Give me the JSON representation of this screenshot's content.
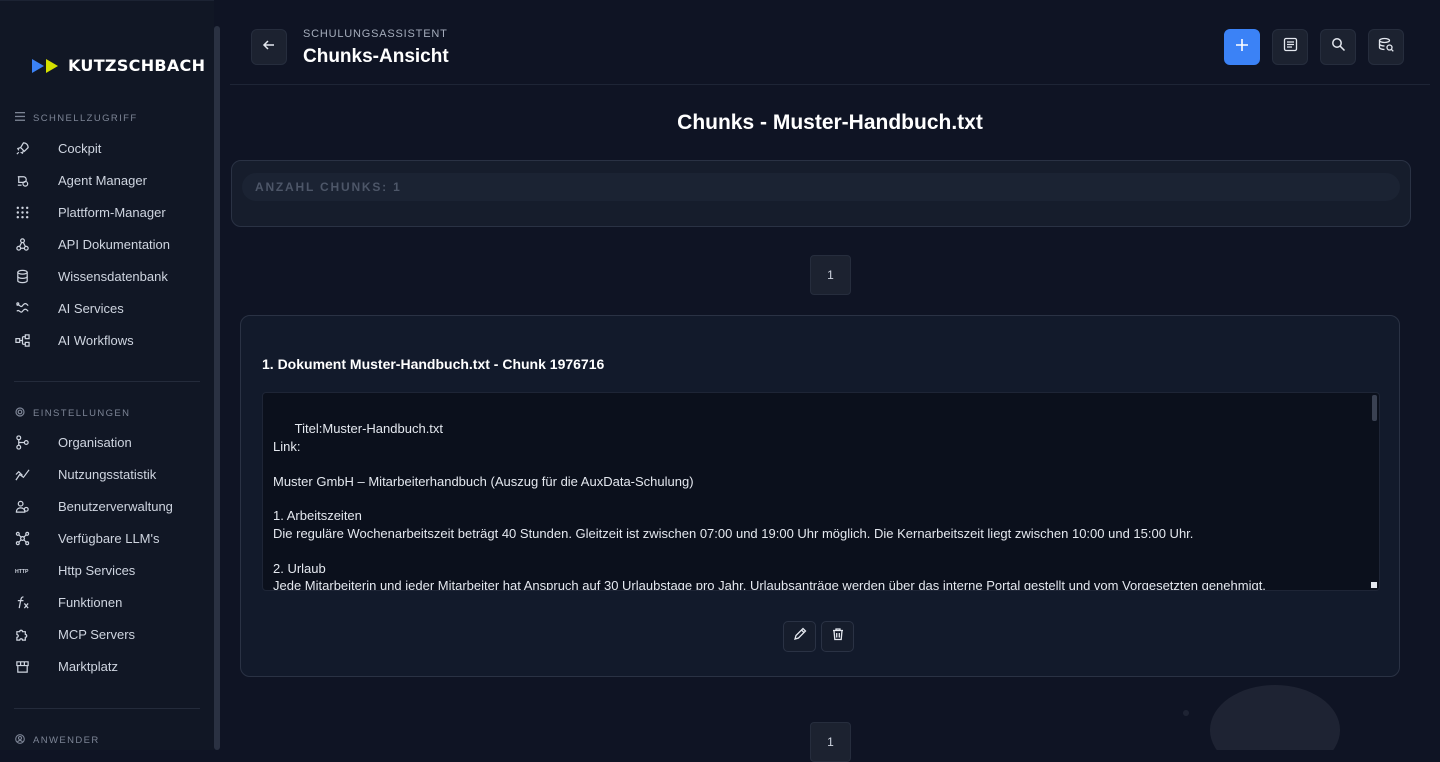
{
  "brand": {
    "name": "KUTZSCHBACH",
    "colors": {
      "accent": "#3b82f6",
      "logo_blue": "#3b82f6",
      "logo_yellow": "#d4e000"
    }
  },
  "sidebar": {
    "sections": [
      {
        "title": "SCHNELLZUGRIFF",
        "icon": "menu-icon",
        "items": [
          {
            "label": "Cockpit",
            "icon": "rocket-icon"
          },
          {
            "label": "Agent Manager",
            "icon": "agent-icon"
          },
          {
            "label": "Plattform-Manager",
            "icon": "grid-icon"
          },
          {
            "label": "API Dokumentation",
            "icon": "webhook-icon"
          },
          {
            "label": "Wissensdatenbank",
            "icon": "database-icon"
          },
          {
            "label": "AI Services",
            "icon": "ai-services-icon"
          },
          {
            "label": "AI Workflows",
            "icon": "workflow-icon"
          }
        ]
      },
      {
        "title": "EINSTELLUNGEN",
        "icon": "gear-icon",
        "items": [
          {
            "label": "Organisation",
            "icon": "org-icon"
          },
          {
            "label": "Nutzungsstatistik",
            "icon": "chart-icon"
          },
          {
            "label": "Benutzerverwaltung",
            "icon": "users-icon"
          },
          {
            "label": "Verfügbare LLM's",
            "icon": "llm-icon"
          },
          {
            "label": "Http Services",
            "icon": "http-icon"
          },
          {
            "label": "Funktionen",
            "icon": "function-icon"
          },
          {
            "label": "MCP Servers",
            "icon": "puzzle-icon"
          },
          {
            "label": "Marktplatz",
            "icon": "store-icon"
          }
        ]
      },
      {
        "title": "ANWENDER",
        "icon": "user-circle-icon",
        "items": []
      }
    ]
  },
  "header": {
    "breadcrumb": "SCHULUNGSASSISTENT",
    "title": "Chunks-Ansicht",
    "actions": [
      "plus-icon",
      "document-icon",
      "search-icon",
      "search-data-icon"
    ]
  },
  "content": {
    "heading": "Chunks - Muster-Handbuch.txt",
    "count_label": "ANZAHL CHUNKS: 1",
    "pagination_top": "1",
    "pagination_bottom": "1",
    "chunk": {
      "title": "1. Dokument Muster-Handbuch.txt - Chunk 1976716",
      "text": "Titel:Muster-Handbuch.txt\nLink:\n\nMuster GmbH – Mitarbeiterhandbuch (Auszug für die AuxData-Schulung)\n\n1. Arbeitszeiten\nDie reguläre Wochenarbeitszeit beträgt 40 Stunden. Gleitzeit ist zwischen 07:00 und 19:00 Uhr möglich. Die Kernarbeitszeit liegt zwischen 10:00 und 15:00 Uhr.\n\n2. Urlaub\nJede Mitarbeiterin und jeder Mitarbeiter hat Anspruch auf 30 Urlaubstage pro Jahr. Urlaubsanträge werden über das interne Portal gestellt und vom Vorgesetzten genehmigt.",
      "actions": [
        "edit-icon",
        "trash-icon"
      ]
    }
  }
}
